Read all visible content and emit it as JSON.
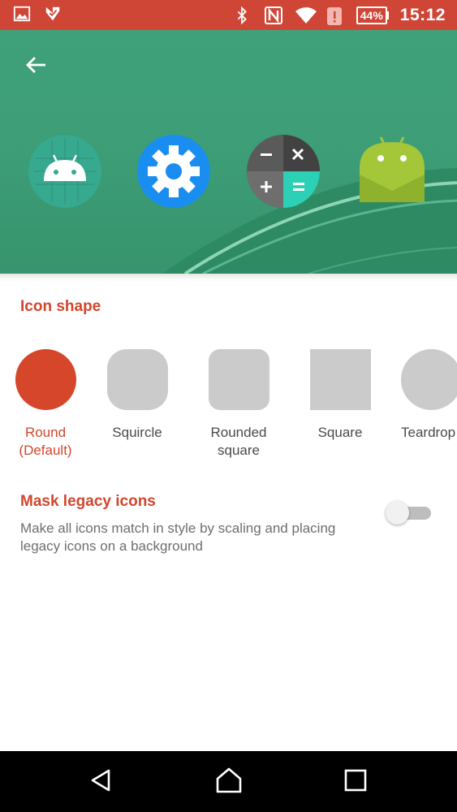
{
  "status_bar": {
    "background": "#cf4637",
    "left_icons": [
      "gallery-icon",
      "download-check-icon"
    ],
    "right_icons": [
      "bluetooth-icon",
      "nfc-icon",
      "wifi-icon",
      "alert-icon"
    ],
    "battery": "44%",
    "time": "15:12"
  },
  "preview": {
    "background": "#3fa17a",
    "back_icon": "arrow-back-icon",
    "icons": [
      "android-app-icon",
      "settings-app-icon",
      "calculator-app-icon",
      "android-legacy-icon"
    ]
  },
  "icon_shape": {
    "title": "Icon shape",
    "accent": "#d2462d",
    "options": [
      {
        "label_line1": "Round",
        "label_line2": "(Default)",
        "shape": "circle",
        "selected": true
      },
      {
        "label_line1": "Squircle",
        "label_line2": "",
        "shape": "squircle",
        "selected": false
      },
      {
        "label_line1": "Rounded",
        "label_line2": "square",
        "shape": "rounded-square",
        "selected": false
      },
      {
        "label_line1": "Square",
        "label_line2": "",
        "shape": "square",
        "selected": false
      },
      {
        "label_line1": "Teardrop",
        "label_line2": "",
        "shape": "teardrop",
        "selected": false
      }
    ]
  },
  "mask_legacy": {
    "title": "Mask legacy icons",
    "description": "Make all icons match in style by scaling and placing legacy icons on a background",
    "enabled": false
  },
  "nav_bar": {
    "buttons": [
      "back-nav-icon",
      "home-nav-icon",
      "recents-nav-icon"
    ]
  }
}
